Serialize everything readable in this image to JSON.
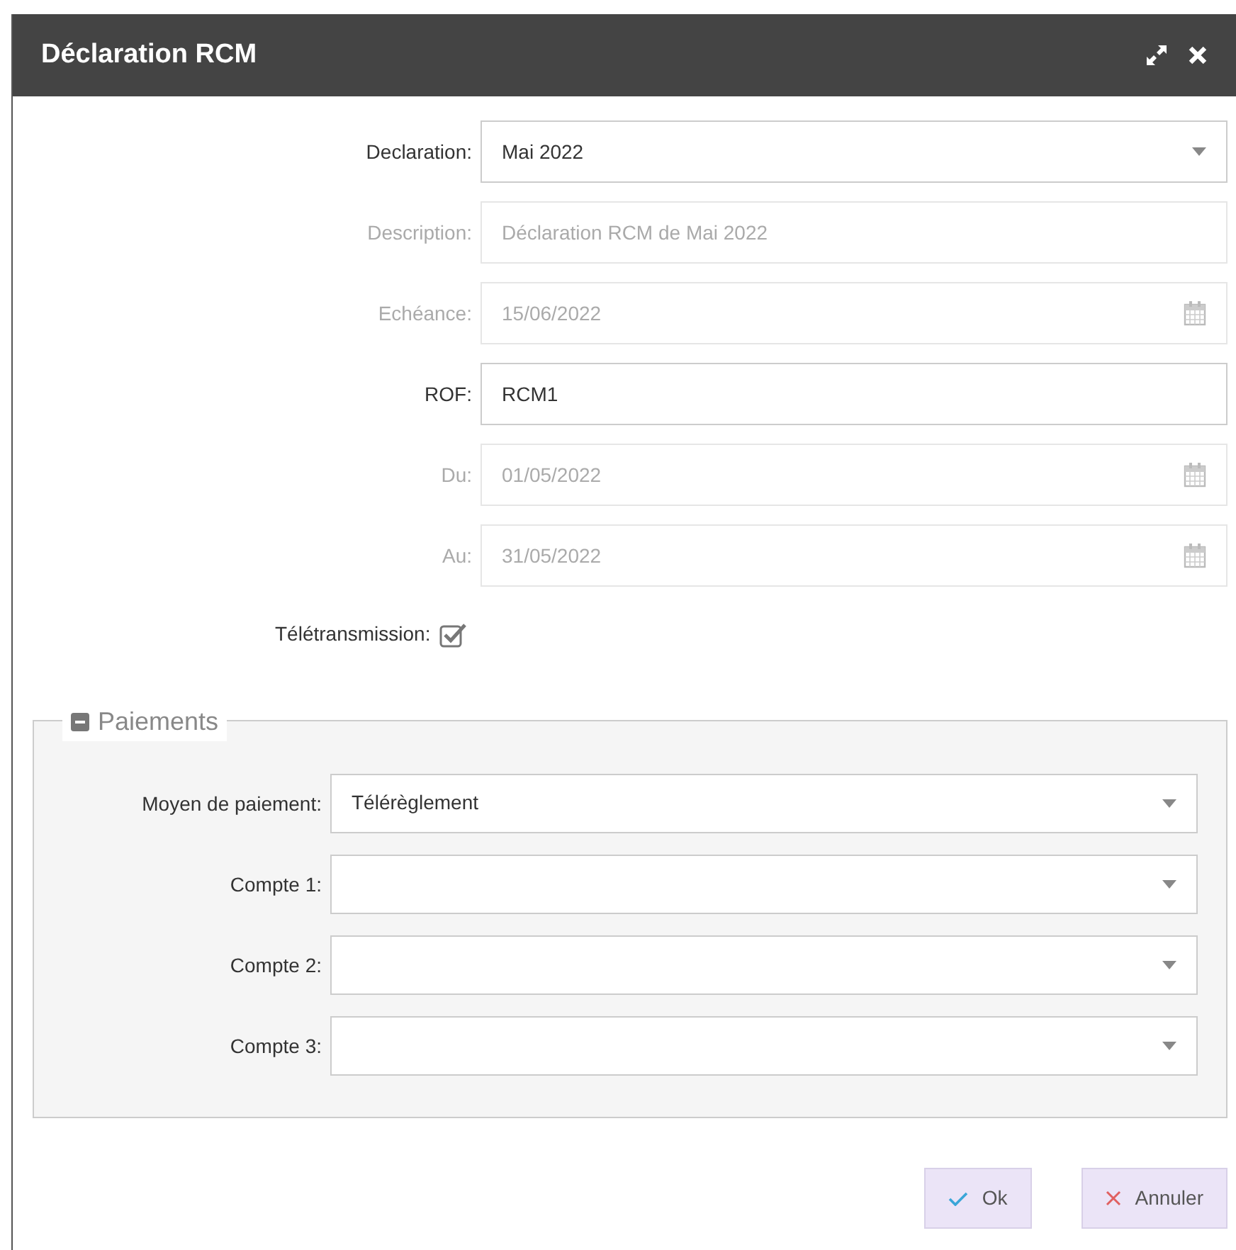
{
  "window": {
    "title": "Déclaration RCM"
  },
  "fields": [
    {
      "label": "Declaration:",
      "value": "Mai 2022",
      "kind": "select",
      "disabled": false
    },
    {
      "label": "Description:",
      "value": "Déclaration RCM de Mai 2022",
      "kind": "text",
      "disabled": true
    },
    {
      "label": "Echéance:",
      "value": "15/06/2022",
      "kind": "date",
      "disabled": true
    },
    {
      "label": "ROF:",
      "value": "RCM1",
      "kind": "text",
      "disabled": false
    },
    {
      "label": "Du:",
      "value": "01/05/2022",
      "kind": "date",
      "disabled": true
    },
    {
      "label": "Au:",
      "value": "31/05/2022",
      "kind": "date",
      "disabled": true
    }
  ],
  "teletransmission": {
    "label": "Télétransmission:",
    "checked": true
  },
  "paiements": {
    "legend": "Paiements",
    "expanded": true,
    "fields": [
      {
        "label": "Moyen de paiement:",
        "value": "Télérèglement"
      },
      {
        "label": "Compte 1:"
      },
      {
        "label": "Compte 2:"
      },
      {
        "label": "Compte 3:"
      }
    ]
  },
  "buttons": [
    {
      "label": "Ok",
      "kind": "ok"
    },
    {
      "label": "Annuler",
      "kind": "cancel"
    }
  ]
}
